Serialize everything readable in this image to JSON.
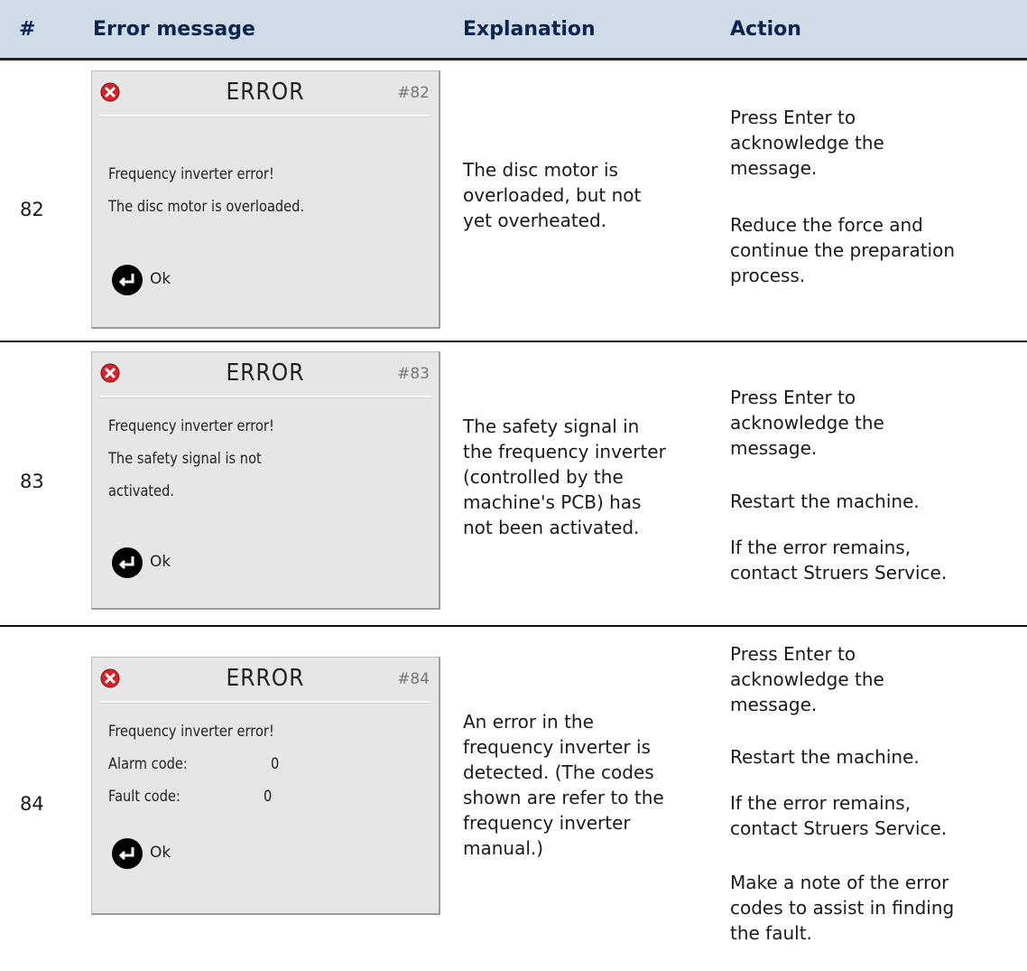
{
  "header": {
    "col_num": "#",
    "col_message": "Error message",
    "col_explanation": "Explanation",
    "col_action": "Action"
  },
  "rows": [
    {
      "number": "82",
      "screen": {
        "title": "ERROR",
        "code": "#82",
        "lines": [
          "Frequency inverter error!",
          "The disc motor is overloaded."
        ],
        "ok_label": "Ok"
      },
      "explanation": [
        "The disc motor is",
        "overloaded, but not",
        "yet overheated."
      ],
      "actions": [
        [
          "Press Enter to",
          "acknowledge the",
          "message."
        ],
        [
          "Reduce the force and",
          "continue the preparation",
          "process."
        ]
      ]
    },
    {
      "number": "83",
      "screen": {
        "title": "ERROR",
        "code": "#83",
        "lines": [
          "Frequency inverter error!",
          "The safety signal is not",
          "activated."
        ],
        "ok_label": "Ok"
      },
      "explanation": [
        "The safety signal in",
        "the frequency inverter",
        "(controlled by the",
        "machine's PCB) has",
        "not been activated."
      ],
      "actions": [
        [
          "Press Enter to",
          "acknowledge the",
          "message."
        ],
        [
          "Restart the machine."
        ],
        [
          "If the error remains,",
          "contact Struers Service."
        ]
      ]
    },
    {
      "number": "84",
      "screen": {
        "title": "ERROR",
        "code": "#84",
        "lines": [
          "Frequency inverter error!"
        ],
        "alarm_label": "Alarm code:",
        "alarm_value": "0",
        "fault_label": "Fault code:",
        "fault_value": "0",
        "ok_label": "Ok"
      },
      "explanation": [
        "An error in the",
        "frequency inverter is",
        "detected. (The codes",
        "shown are refer to the",
        "frequency inverter",
        "manual.)"
      ],
      "actions": [
        [
          "Press Enter to",
          "acknowledge the",
          "message."
        ],
        [
          "Restart the machine."
        ],
        [
          "If the error remains,",
          "contact Struers Service."
        ],
        [
          "Make a note of the error",
          "codes to assist in finding",
          "the fault."
        ]
      ]
    }
  ],
  "colors": {
    "header_bg": "#cfdbe7",
    "header_text": "#0b2550",
    "error_icon": "#d8232a"
  },
  "icons": {
    "error": "error-circle-x-icon",
    "enter": "enter-return-icon"
  }
}
